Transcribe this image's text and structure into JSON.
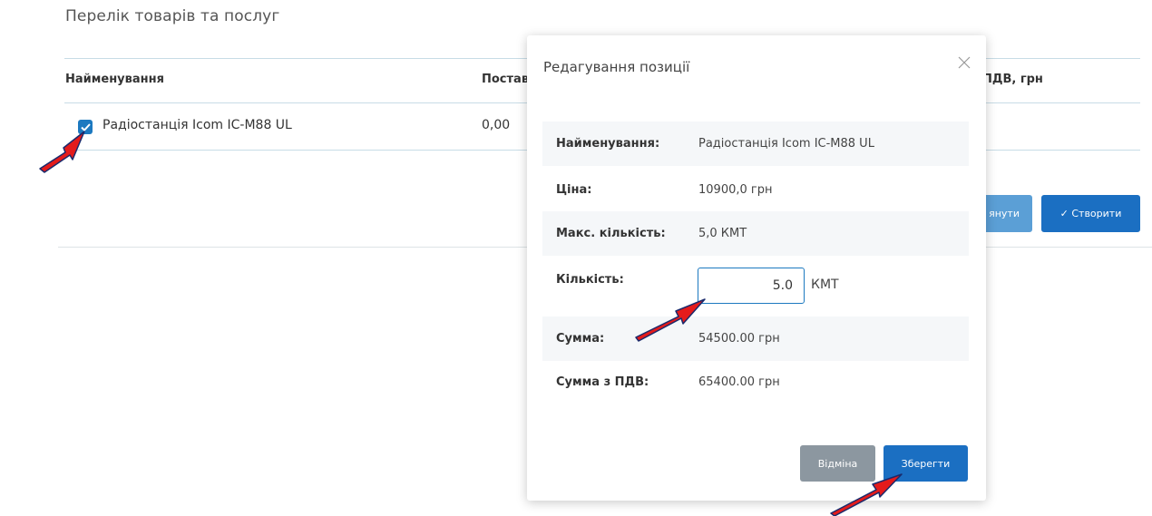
{
  "page": {
    "section_title": "Перелік товарів та послуг"
  },
  "table": {
    "headers": {
      "name": "Найменування",
      "supplier": "Постав",
      "vat": "ПДВ, грн"
    },
    "row": {
      "name": "Радіостанція Icom IC-M88 UL",
      "value": "0,00",
      "checked": true
    }
  },
  "actions": {
    "cancel_label": "янути",
    "create_label": "✓ Створити"
  },
  "modal": {
    "title": "Редагування позиції",
    "fields": {
      "name_label": "Найменування:",
      "name_value": "Радіостанція Icom IC-M88 UL",
      "price_label": "Ціна:",
      "price_value": "10900,0 грн",
      "max_qty_label": "Макс. кількість:",
      "max_qty_value": "5,0 КМТ",
      "qty_label": "Кількість:",
      "qty_value": "5.0",
      "qty_unit": "КМТ",
      "sum_label": "Сумма:",
      "sum_value": "54500.00 грн",
      "sum_vat_label": "Сумма з ПДВ:",
      "sum_vat_value": "65400.00 грн"
    },
    "discard_label": "Відміна",
    "save_label": "Зберегти"
  },
  "colors": {
    "primary": "#1b6fc2",
    "checkbox": "#1c79c0",
    "secondary_button": "#8c97a0",
    "annotation_arrow": "#e41b1b"
  },
  "icons": [
    "check-icon",
    "close-icon",
    "annotation-arrow"
  ]
}
